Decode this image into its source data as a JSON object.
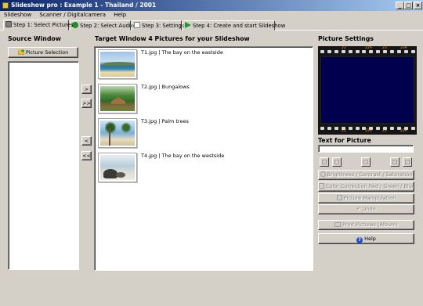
{
  "window": {
    "title": "Slideshow pro : Example 1 - Thailand / 2001"
  },
  "menu": [
    "Slideshow",
    "Scanner / Digitalcamera",
    "Help"
  ],
  "tabs": [
    {
      "label": "Step 1: Select Pictures",
      "icon": "camera-icon"
    },
    {
      "label": "Step 2: Select Audio",
      "icon": "audio-icon"
    },
    {
      "label": "Step 3: Settings",
      "icon": "settings-icon"
    },
    {
      "label": "Step 4: Create and start Slideshow",
      "icon": "play-icon"
    }
  ],
  "source": {
    "heading": "Source Window",
    "picture_selection_label": "Picture Selection"
  },
  "target": {
    "heading": "Target Window 4 Pictures for your Slideshow",
    "pictures": [
      {
        "label": "T1.jpg | The bay on the eastside",
        "scene": "bay-east"
      },
      {
        "label": "T2.jpg | Bungalows",
        "scene": "bungalows"
      },
      {
        "label": "T3.jpg | Palm trees",
        "scene": "palm-trees"
      },
      {
        "label": "T4.jpg | The bay on the westside",
        "scene": "bay-west"
      }
    ]
  },
  "transfer_buttons": {
    "add_one": ">",
    "add_all": ">>",
    "remove_one": "<",
    "remove_all": "<<"
  },
  "settings": {
    "heading": "Picture Settings",
    "film_marks": [
      "22",
      "22A",
      "23",
      "23A",
      "22",
      "22A",
      "23",
      "23A"
    ],
    "text_heading": "Text for Picture",
    "text_value": "",
    "brightness_label": "Brightness / Contrast / Saturation",
    "color_label": "Color Correction Red / Green / Blue",
    "manipulation_label": "Picture Manipulation",
    "undo_label": "Undo",
    "print_label": "Print Pictures (Album)",
    "help_label": "Help"
  },
  "colors": {
    "titlebar_start": "#0a246a",
    "titlebar_end": "#a6caf0",
    "face": "#d4d0c8",
    "film_frame": "#00004f",
    "help_icon": "#1f4fbf"
  }
}
